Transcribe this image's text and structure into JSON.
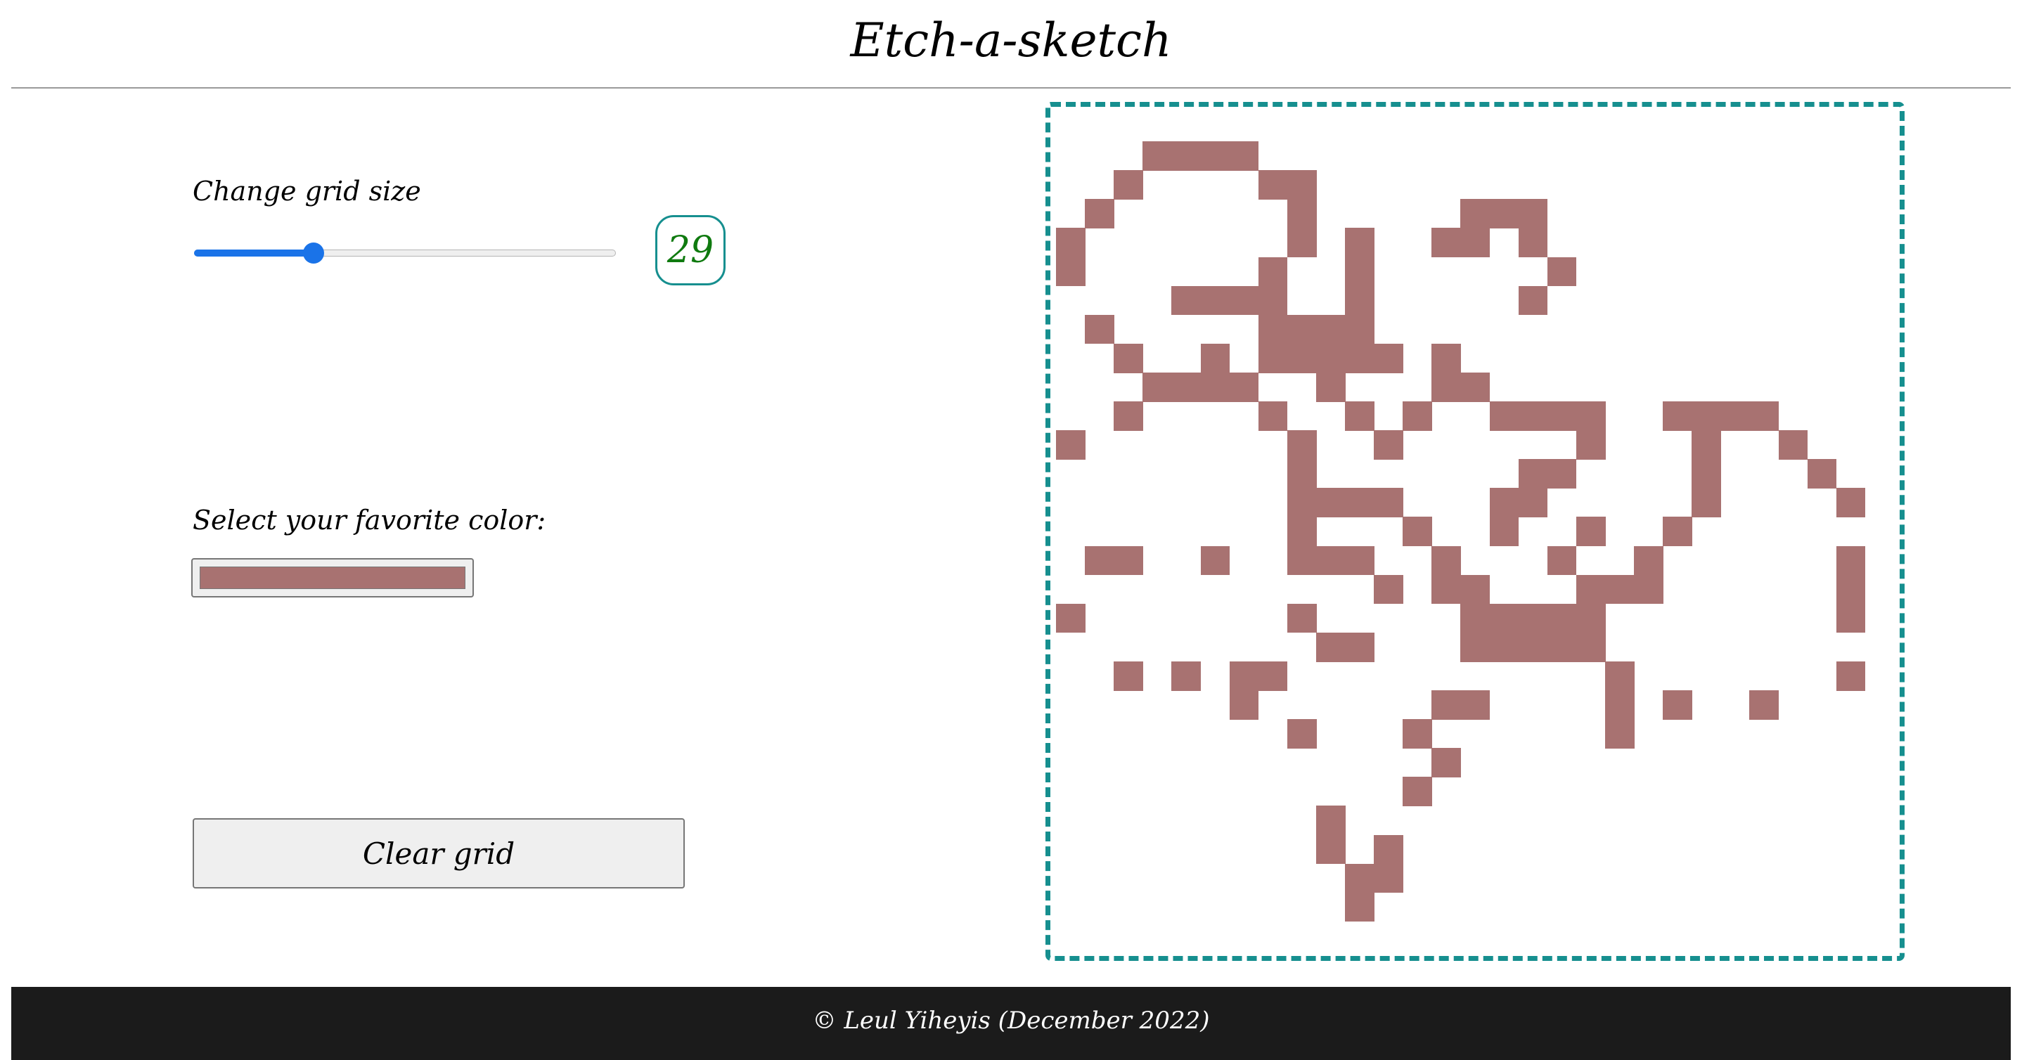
{
  "header": {
    "title": "Etch-a-sketch"
  },
  "controls": {
    "grid_size_label": "Change grid size",
    "grid_size_value": "29",
    "slider": {
      "min": 1,
      "max": 100,
      "value": 29
    },
    "color_label": "Select your favorite color:",
    "selected_color": "#a87271",
    "clear_label": "Clear grid"
  },
  "colors": {
    "accent": "#168f8f",
    "slider": "#1a73e8",
    "size_value_text": "#0f7a0f",
    "footer_bg": "#1b1b1b"
  },
  "grid": {
    "size": 29,
    "paint_color": "#a87271",
    "rows": [
      ".............................",
      "...####......................",
      "..#....##....................",
      ".#......#.....###............",
      "#.......#.#..##.#............",
      "#......#..#......#...........",
      "....####..#.....#............",
      ".#.....####..................",
      "..#..#.#####.#...............",
      "...####..#...##..............",
      "..#....#..#.#..####..####....",
      "#.......#..#......#...#..#...",
      "........#.......##....#...#..",
      "........####...##.....#....#.",
      "........#...#..#..#..#.......",
      ".##..#..###..#...#..#......#.",
      "...........#.##...###......#.",
      "#.......#.....#####........#.",
      ".........##...#####..........",
      "..#.#.##...........#.......#.",
      "......#......##....#.#..#....",
      "........#...#......#.........",
      ".............#...............",
      "............#................",
      ".........#...................",
      ".........#.#.................",
      "..........##.................",
      "..........#..................",
      "............................."
    ]
  },
  "footer": {
    "text": "© Leul Yiheyis (December 2022)"
  }
}
